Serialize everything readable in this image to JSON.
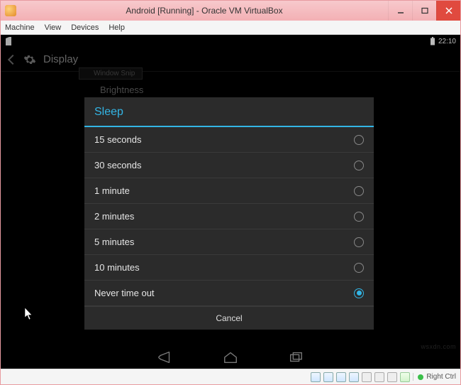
{
  "host": {
    "title": "Android [Running] - Oracle VM VirtualBox",
    "menus": [
      "Machine",
      "View",
      "Devices",
      "Help"
    ],
    "host_key_label": "Right Ctrl"
  },
  "android": {
    "statusbar": {
      "time": "22:10"
    },
    "settings_screen_title": "Display",
    "snip_badge": "Window Snip",
    "brightness_label": "Brightness"
  },
  "dialog": {
    "title": "Sleep",
    "options": [
      {
        "label": "15 seconds",
        "selected": false
      },
      {
        "label": "30 seconds",
        "selected": false
      },
      {
        "label": "1 minute",
        "selected": false
      },
      {
        "label": "2 minutes",
        "selected": false
      },
      {
        "label": "5 minutes",
        "selected": false
      },
      {
        "label": "10 minutes",
        "selected": false
      },
      {
        "label": "Never time out",
        "selected": true
      }
    ],
    "cancel_label": "Cancel"
  },
  "watermark": "wsxdn.com"
}
